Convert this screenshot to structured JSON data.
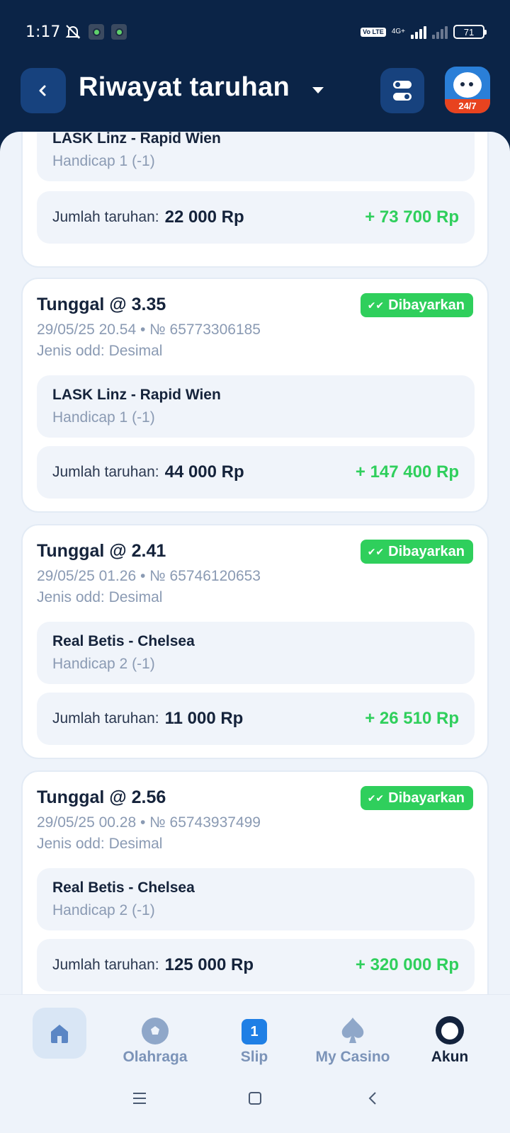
{
  "status_bar": {
    "time": "1:17",
    "network": "4G+",
    "volte": "Vo LTE",
    "battery": "71"
  },
  "header": {
    "title": "Riwayat taruhan",
    "support_badge": "24/7"
  },
  "partial_card": {
    "event": "LASK Linz - Rapid Wien",
    "market": "Handicap 1 (-1)",
    "stake_label": "Jumlah taruhan:",
    "stake": "22 000 Rp",
    "win": "+ 73 700 Rp"
  },
  "bets": [
    {
      "title": "Tunggal @ 3.35",
      "status": "Dibayarkan",
      "datetime_id": "29/05/25 20.54  •  № 65773306185",
      "odds_type": "Jenis odd: Desimal",
      "event": "LASK Linz - Rapid Wien",
      "market": "Handicap 1 (-1)",
      "stake_label": "Jumlah taruhan:",
      "stake": "44 000 Rp",
      "win": "+ 147 400 Rp"
    },
    {
      "title": "Tunggal @ 2.41",
      "status": "Dibayarkan",
      "datetime_id": "29/05/25 01.26  •  № 65746120653",
      "odds_type": "Jenis odd: Desimal",
      "event": "Real Betis - Chelsea",
      "market": "Handicap 2 (-1)",
      "stake_label": "Jumlah taruhan:",
      "stake": "11 000 Rp",
      "win": "+ 26 510 Rp"
    },
    {
      "title": "Tunggal @ 2.56",
      "status": "Dibayarkan",
      "datetime_id": "29/05/25 00.28  •  № 65743937499",
      "odds_type": "Jenis odd: Desimal",
      "event": "Real Betis - Chelsea",
      "market": "Handicap 2 (-1)",
      "stake_label": "Jumlah taruhan:",
      "stake": "125 000 Rp",
      "win": "+ 320 000 Rp"
    }
  ],
  "bottom_nav": {
    "sports": "Olahraga",
    "slip": "Slip",
    "slip_count": "1",
    "casino": "My Casino",
    "account": "Akun"
  },
  "colors": {
    "header_bg": "#0b2447",
    "accent_blue": "#1f7fe5",
    "paid_green": "#2fcf5c",
    "sheet_bg": "#eef3fa"
  }
}
